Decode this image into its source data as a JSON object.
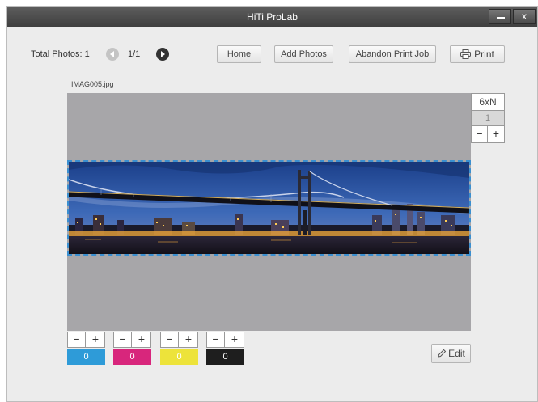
{
  "window": {
    "title": "HiTi ProLab",
    "minimize_icon": "minimize-icon",
    "close_label": "x"
  },
  "toolbar": {
    "total_photos": "Total Photos: 1",
    "page_count": "1/1",
    "home_label": "Home",
    "add_photos_label": "Add Photos",
    "abandon_label": "Abandon Print Job",
    "print_label": "Print"
  },
  "photo": {
    "filename": "IMAG005.jpg",
    "image_icon": "bridge-night-panorama",
    "size_label": "6xN",
    "copies": "1",
    "minus_label": "−",
    "plus_label": "+"
  },
  "colors": [
    {
      "name": "cyan",
      "value": "0",
      "color": "#2e9bd8",
      "minus": "−",
      "plus": "+"
    },
    {
      "name": "magenta",
      "value": "0",
      "color": "#d8267c",
      "minus": "−",
      "plus": "+"
    },
    {
      "name": "yellow",
      "value": "0",
      "color": "#ede33a",
      "minus": "−",
      "plus": "+"
    },
    {
      "name": "black",
      "value": "0",
      "color": "#1e1e1e",
      "minus": "−",
      "plus": "+"
    }
  ],
  "edit": {
    "label": "Edit"
  }
}
